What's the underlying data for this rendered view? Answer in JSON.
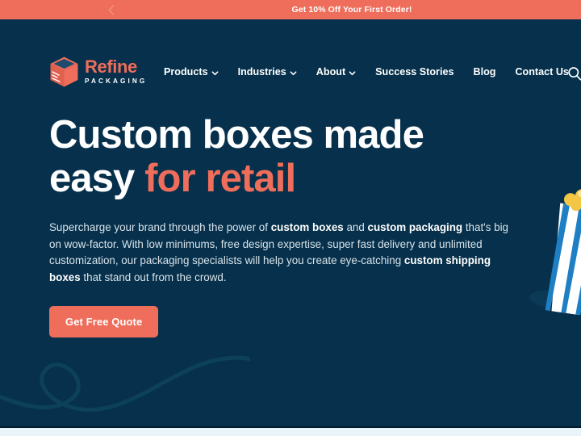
{
  "announcement": {
    "text": "Get 10% Off Your First Order!",
    "prev_icon": "chevron-left-icon",
    "background": "#ee6d5b"
  },
  "brand": {
    "name": "Refine",
    "tagline": "PACKAGING",
    "logo_icon": "cube-box-icon",
    "name_color": "#ee6d5b"
  },
  "nav": {
    "items": [
      {
        "label": "Products",
        "has_dropdown": true
      },
      {
        "label": "Industries",
        "has_dropdown": true
      },
      {
        "label": "About",
        "has_dropdown": true
      },
      {
        "label": "Success Stories",
        "has_dropdown": false
      },
      {
        "label": "Blog",
        "has_dropdown": false
      },
      {
        "label": "Contact Us",
        "has_dropdown": false
      }
    ],
    "search_icon": "search-icon"
  },
  "hero": {
    "title_line1": "Custom boxes made",
    "title_line2_plain": "easy ",
    "title_line2_accent": "for retail",
    "paragraph": {
      "p1": "Supercharge your brand through the power of ",
      "b1": "custom boxes",
      "p2": " and ",
      "b2": "custom packaging",
      "p3": " that's big on wow-factor. With low minimums, free design expertise, super fast delivery and unlimited customization, our packaging specialists will help you create eye-catching ",
      "b3": "custom shipping boxes",
      "p4": " that stand out from the crowd."
    },
    "cta_label": "Get Free Quote",
    "background": "#06304b",
    "accent": "#ee6d5b",
    "art_alt": "striped-popcorn-box"
  }
}
